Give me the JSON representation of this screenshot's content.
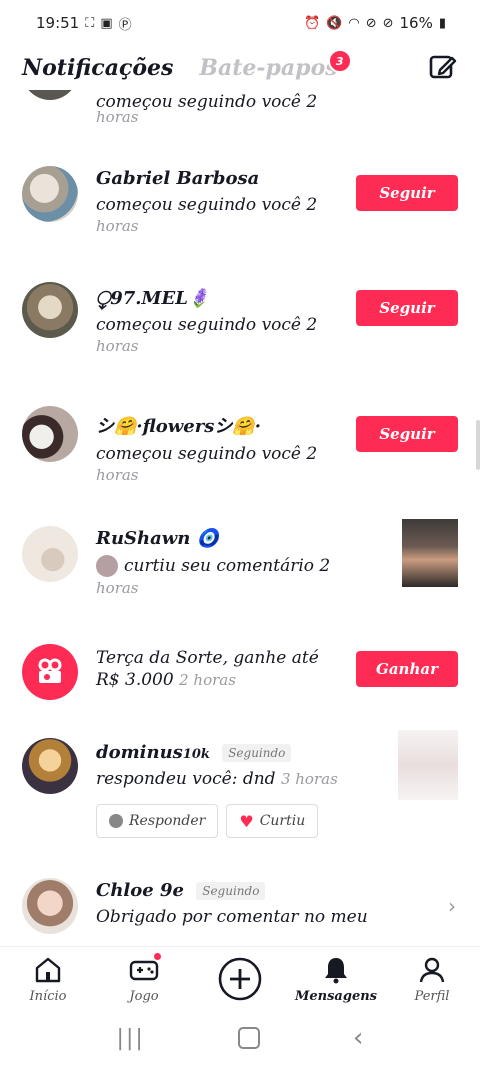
{
  "status": {
    "time": "19:51",
    "battery": "16%"
  },
  "header": {
    "tab_notifications": "Notificações",
    "tab_chats": "Bate-papos",
    "chats_badge": "3"
  },
  "feed": {
    "item0": {
      "text": "começou seguindo você 2",
      "time": "horas"
    },
    "item1": {
      "name": "Gabriel Barbosa",
      "text": "começou seguindo você 2",
      "time": "horas",
      "button": "Seguir"
    },
    "item2": {
      "name": "⧬97.MEL🪻",
      "text": "começou seguindo você 2",
      "time": "horas",
      "button": "Seguir"
    },
    "item3": {
      "name": "シ🤗·flowersシ🤗·",
      "text": "começou seguindo você 2",
      "time": "horas",
      "button": "Seguir"
    },
    "item4": {
      "name": "RuShawn 🧿",
      "text": "curtiu seu comentário 2",
      "time": "horas"
    },
    "item5": {
      "line1": "Terça da Sorte, ganhe até",
      "line2": "R$ 3.000",
      "time": "2 horas",
      "button": "Ganhar"
    },
    "item6": {
      "name": "dominus",
      "suffix": "10k",
      "following": "Seguindo",
      "text": "respondeu você: dnd",
      "time": "3 horas",
      "reply": "Responder",
      "liked": "Curtiu"
    },
    "item7": {
      "name": "Chloe 9e",
      "following": "Seguindo",
      "text": "Obrigado por comentar no meu"
    }
  },
  "nav": {
    "home": "Início",
    "game": "Jogo",
    "messages": "Mensagens",
    "profile": "Perfil"
  },
  "colors": {
    "accent": "#fe2c55"
  }
}
